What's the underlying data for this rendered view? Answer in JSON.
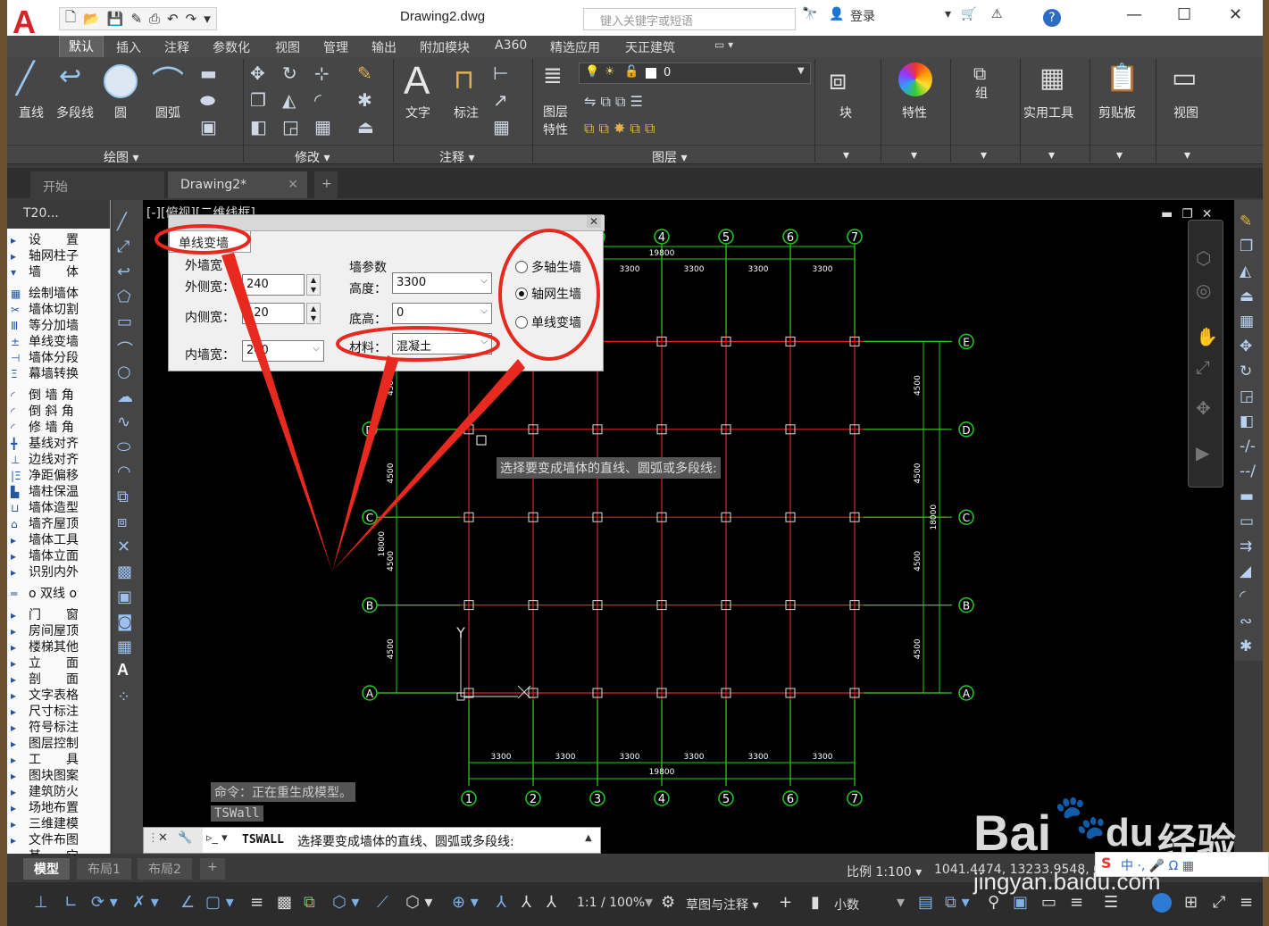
{
  "window": {
    "title": "Drawing2.dwg",
    "search_placeholder": "键入关键字或短语",
    "login": "登录"
  },
  "menu": [
    "默认",
    "插入",
    "注释",
    "参数化",
    "视图",
    "管理",
    "输出",
    "附加模块",
    "A360",
    "精选应用",
    "天正建筑"
  ],
  "ribbon": {
    "draw": [
      "直线",
      "多段线",
      "圆",
      "圆弧"
    ],
    "draw_group": "绘图",
    "modify_group": "修改",
    "annot": [
      "文字",
      "标注"
    ],
    "annot_group": "注释",
    "layer_btn": "图层\n特性",
    "layer_value": "0",
    "layer_group": "图层",
    "right": [
      "块",
      "特性",
      "组",
      "实用工具",
      "剪贴板",
      "视图"
    ]
  },
  "doc_tabs": [
    "开始",
    "Drawing2*"
  ],
  "viewport_label": "[-][俯视][二维线框]",
  "left_panel": {
    "title": "T20...",
    "items": [
      "设　　置",
      "轴网柱子",
      "墙　　体",
      "绘制墙体",
      "墙体切割",
      "等分加墙",
      "单线变墙",
      "墙体分段",
      "幕墙转换",
      "倒 墙 角",
      "倒 斜 角",
      "修 墙 角",
      "基线对齐",
      "边线对齐",
      "净距偏移",
      "墙柱保温",
      "墙体造型",
      "墙齐屋顶",
      "墙体工具",
      "墙体立面",
      "识别内外",
      "o 双线 o",
      "门　　窗",
      "房间屋顶",
      "楼梯其他",
      "立　　面",
      "剖　　面",
      "文字表格",
      "尺寸标注",
      "符号标注",
      "图层控制",
      "工　　具",
      "图块图案",
      "建筑防火",
      "场地布置",
      "三维建模",
      "文件布图",
      "其　　它"
    ]
  },
  "dialog": {
    "title": "单线变墙",
    "outer_group": "外墙宽",
    "outer_width_label": "外侧宽：",
    "outer_width": "240",
    "inner_width_label": "内侧宽：",
    "inner_width": "120",
    "inner_wall_label": "内墙宽：",
    "inner_wall": "240",
    "wall_params": "墙参数",
    "height_label": "高度：",
    "height": "3300",
    "base_label": "底高：",
    "base": "0",
    "material_label": "材料：",
    "material": "混凝土",
    "options": [
      "多轴生墙",
      "轴网生墙",
      "单线变墙"
    ],
    "selected": "轴网生墙"
  },
  "drawing": {
    "columns": [
      "1",
      "2",
      "3",
      "4",
      "5",
      "6",
      "7"
    ],
    "rows": [
      "A",
      "B",
      "C",
      "D",
      "E"
    ],
    "spacing_x": "3300",
    "total_x": "19800",
    "spacing_y": "4500",
    "total_y": "18000",
    "prompt": "选择要变成墙体的直线、圆弧或多段线:",
    "ucs_label": "Y"
  },
  "command": {
    "history1": "命令：正在重生成模型。",
    "history2": "TSWall",
    "current_cmd": "TSWALL",
    "current_prompt": "选择要变成墙体的直线、圆弧或多段线:"
  },
  "layout_tabs": [
    "模型",
    "布局1",
    "布局2"
  ],
  "status": {
    "scale": "比例 1:100",
    "coords": "1041.4474, 13233.9548, 0.000",
    "zoom": "1:1 / 100%",
    "workspace": "草图与注释",
    "units": "小数"
  },
  "watermark": {
    "brand": "Bai",
    "brand2": "du",
    "site": "经验",
    "url": "jingyan.baidu.com"
  }
}
